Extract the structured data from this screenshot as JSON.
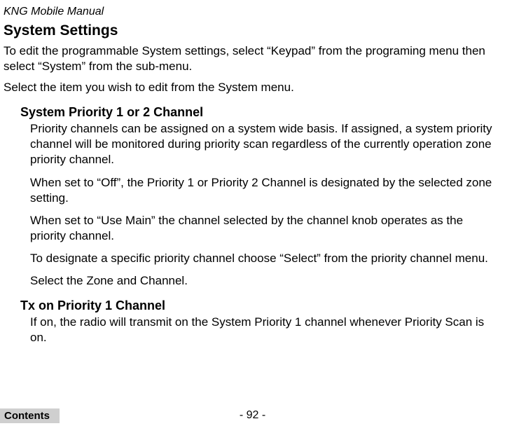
{
  "header": {
    "doc_title": "KNG Mobile Manual"
  },
  "title": "System Settings",
  "intro": [
    "To edit the programmable System settings, select “Keypad” from the programing menu then select “System” from the sub-menu.",
    "Select the item you wish to edit from the System menu."
  ],
  "sections": [
    {
      "heading": "System Priority 1 or 2 Channel",
      "paragraphs": [
        "Priority channels can be assigned on a system wide basis. If assigned, a system priority channel will be monitored during priority scan regardless of the currently operation zone priority channel.",
        "When set to “Off”, the Priority 1 or Priority 2 Channel is designated by the selected zone setting.",
        "When set to “Use Main” the channel selected by the channel knob operates as the priority channel.",
        "To designate a specific priority channel choose “Select” from the priority channel menu.",
        "Select the Zone and Channel."
      ]
    },
    {
      "heading": "Tx on Priority 1 Channel",
      "paragraphs": [
        "If on, the radio will transmit on the System Priority 1 channel whenever Priority Scan is on."
      ]
    }
  ],
  "footer": {
    "page_number": "- 92 -",
    "contents_label": "Contents"
  }
}
